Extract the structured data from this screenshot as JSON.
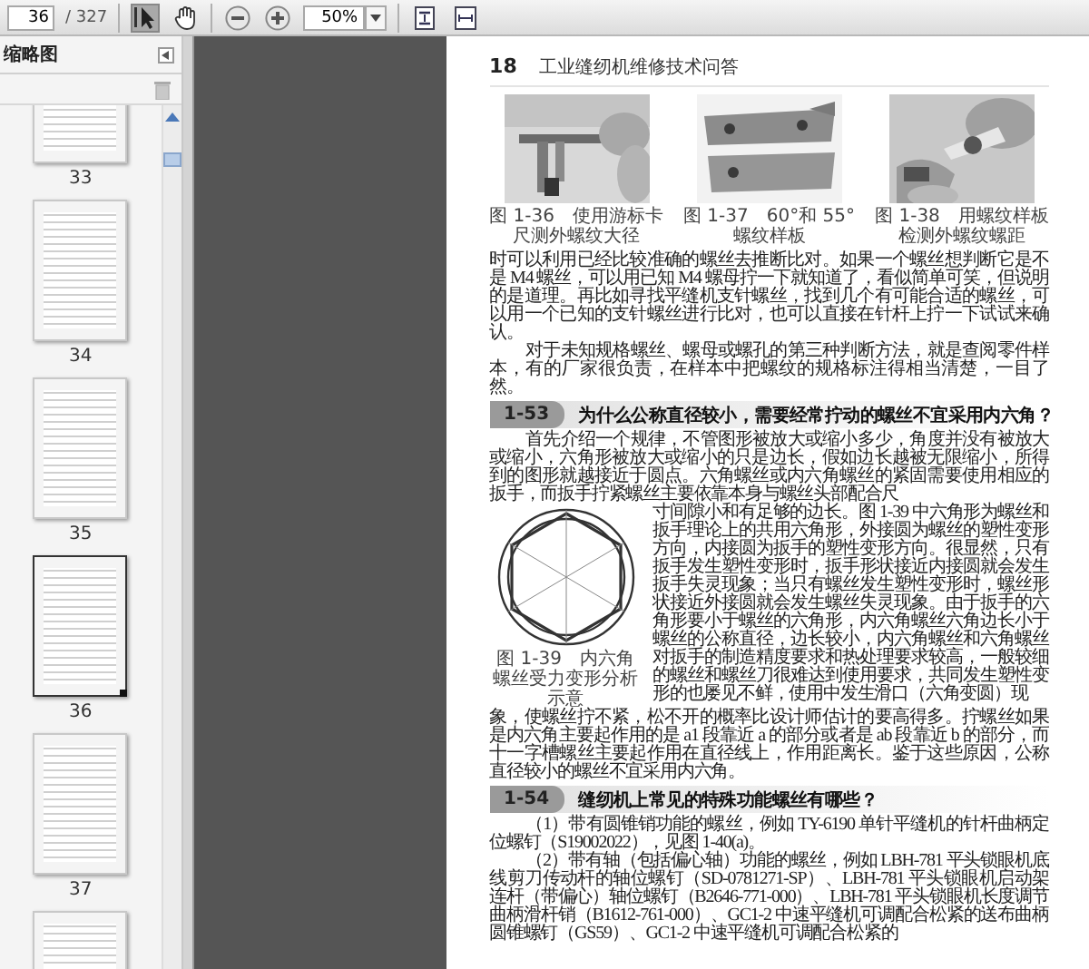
{
  "toolbar": {
    "page_number": "36",
    "page_count": "/ 327",
    "tools": [
      {
        "kind": "select",
        "selected": true
      },
      {
        "kind": "hand",
        "selected": false
      }
    ],
    "zoom": "50%"
  },
  "sidebar": {
    "title": "缩略图",
    "thumbnails": [
      {
        "label": "33",
        "selected": false
      },
      {
        "label": "34",
        "selected": false
      },
      {
        "label": "35",
        "selected": false
      },
      {
        "label": "36",
        "selected": true
      },
      {
        "label": "37",
        "selected": false
      },
      {
        "selected": false
      }
    ]
  },
  "page": {
    "page_number": "18",
    "running_title": "工业缝纫机维修技术问答",
    "figures": [
      {
        "kind": "picture",
        "caption": "图 1-36　使用游标卡尺测外螺纹大径"
      },
      {
        "kind": "picture",
        "caption": "图 1-37　60°和 55°螺纹样板"
      },
      {
        "kind": "picture",
        "caption": "图 1-38　用螺纹样板检测外螺纹螺距"
      }
    ],
    "blocks": [
      {
        "kind": "paragraph",
        "indent": false,
        "text": "时可以利用已经比较准确的螺丝去推断比对。如果一个螺丝想判断它是不是 M4 螺丝，可以用已知 M4 螺母拧一下就知道了，看似简单可笑，但说明的是道理。再比如寻找平缝机支针螺丝，找到几个有可能合适的螺丝，可以用一个已知的支针螺丝进行比对，也可以直接在针杆上拧一下试试来确认。"
      },
      {
        "kind": "paragraph",
        "indent": true,
        "text": "对于未知规格螺丝、螺母或螺孔的第三种判断方法，就是查阅零件样本，有的厂家很负责，在样本中把螺纹的规格标注得相当清楚，一目了然。"
      },
      {
        "kind": "heading",
        "number": "1-53",
        "title": "为什么公称直径较小，需要经常拧动的螺丝不宜采用内六角？"
      },
      {
        "kind": "figure_paragraph",
        "caption": "图 1-39　内六角螺丝受力变形分析示意",
        "lead": "首先介绍一个规律，不管图形被放大或缩小多少，角度并没有被放大或缩小，六角形被放大或缩小的只是边长，假如边长越被无限缩小，所得到的图形就越接近于圆点。六角螺丝或内六角螺丝的紧固需要使用相应的扳手，而扳手拧紧螺丝主要依靠本身与螺丝头部配合尺",
        "beside": "寸间隙小和有足够的边长。图 1-39 中六角形为螺丝和扳手理论上的共用六角形，外接圆为螺丝的塑性变形方向，内接圆为扳手的塑性变形方向。很显然，只有扳手发生塑性变形时，扳手形状接近内接圆就会发生扳手失灵现象；当只有螺丝发生塑性变形时，螺丝形状接近外接圆就会发生螺丝失灵现象。由于扳手的六角形要小于螺丝的六角形，内六角螺丝六角边长小于螺丝的公称直径，边长较小，内六角螺丝和六角螺丝对扳手的制造精度要求和热处理要求较高，一般较细的螺丝和螺丝刀很难达到使用要求，共同发生塑性变形的也屡见不鲜，使用中发生滑口（六角变圆）现",
        "text": "象，使螺丝拧不紧，松不开的概率比设计师估计的要高得多。拧螺丝如果是内六角主要起作用的是 a1 段靠近 a 的部分或者是 ab 段靠近 b 的部分，而十一字槽螺丝主要起作用在直径线上，作用距离长。鉴于这些原因，公称直径较小的螺丝不宜采用内六角。"
      },
      {
        "kind": "heading",
        "number": "1-54",
        "title": "缝纫机上常见的特殊功能螺丝有哪些？"
      },
      {
        "kind": "paragraph",
        "indent": true,
        "text": "（1）带有圆锥销功能的螺丝，例如 TY-6190 单针平缝机的针杆曲柄定位螺钉（S19002022），见图 1-40(a)。"
      },
      {
        "kind": "paragraph",
        "indent": true,
        "text": "（2）带有轴（包括偏心轴）功能的螺丝，例如 LBH-781 平头锁眼机底线剪刀传动杆的轴位螺钉（SD-0781271-SP）、LBH-781 平头锁眼机启动架连杆（带偏心）轴位螺钉（B2646-771-000）、LBH-781 平头锁眼机长度调节曲柄滑杆销（B1612-761-000）、GC1-2 中速平缝机可调配合松紧的送布曲柄圆锥螺钉（GS59）、GC1-2 中速平缝机可调配合松紧的"
      }
    ]
  }
}
